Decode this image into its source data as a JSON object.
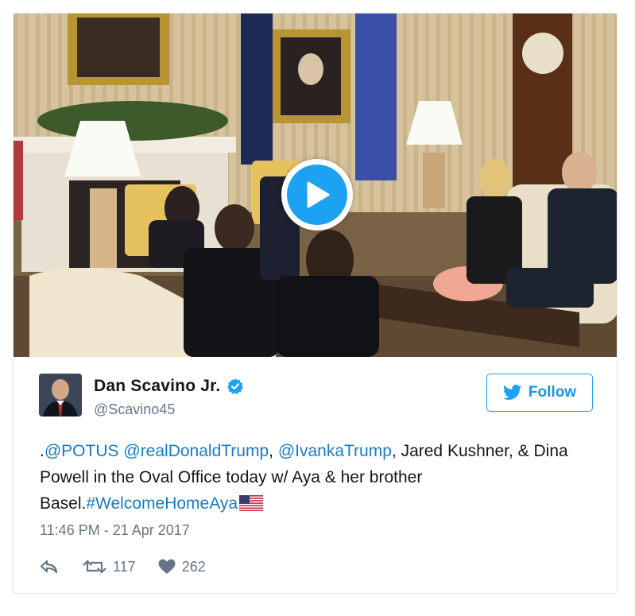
{
  "media": {
    "icon": "play-icon",
    "play_color": "#1da1f2"
  },
  "author": {
    "display_name": "Dan Scavino Jr.",
    "handle": "@Scavino45",
    "verified_icon": "verified-badge-icon"
  },
  "follow": {
    "label": "Follow",
    "icon": "twitter-bird-icon",
    "color": "#1da1f2"
  },
  "tweet": {
    "segments": [
      {
        "text": ".",
        "type": "text"
      },
      {
        "text": "@POTUS",
        "type": "link"
      },
      {
        "text": " ",
        "type": "text"
      },
      {
        "text": "@realDonaldTrump",
        "type": "link"
      },
      {
        "text": ", ",
        "type": "text"
      },
      {
        "text": "@IvankaTrump",
        "type": "link"
      },
      {
        "text": ", Jared Kushner, & Dina Powell in the Oval Office today w/ Aya & her brother Basel.",
        "type": "text"
      },
      {
        "text": "#WelcomeHomeAya",
        "type": "link"
      }
    ],
    "emoji": "us-flag-icon",
    "timestamp": "11:46 PM - 21 Apr 2017"
  },
  "actions": {
    "reply_icon": "reply-icon",
    "retweet_icon": "retweet-icon",
    "retweet_count": "117",
    "like_icon": "heart-icon",
    "like_count": "262"
  },
  "colors": {
    "link": "#1b7bc4",
    "secondary_text": "#657786",
    "border": "#e1e8ed"
  }
}
